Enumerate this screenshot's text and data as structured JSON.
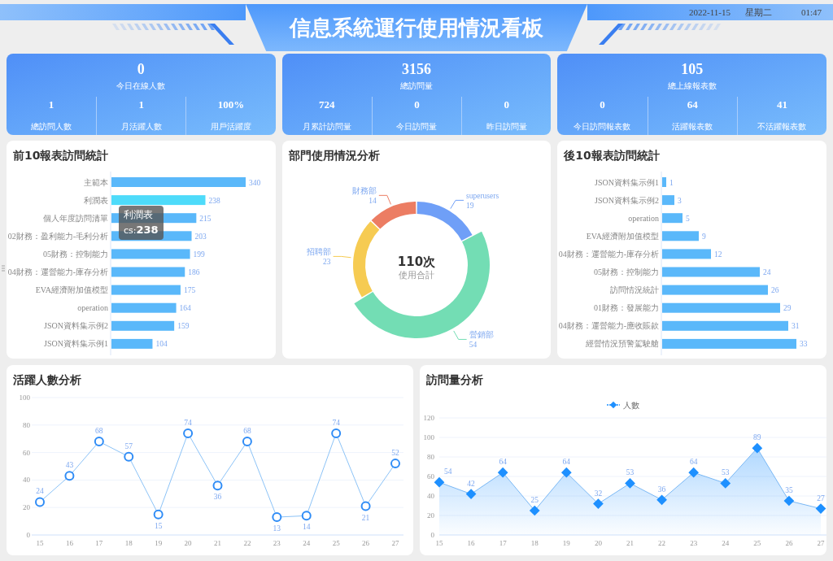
{
  "header": {
    "title": "信息系統運行使用情況看板",
    "date": "2022-11-15",
    "weekday": "星期二",
    "time": "01:47"
  },
  "stats": [
    {
      "value": "0",
      "label": "今日在線人數",
      "items": [
        {
          "value": "1",
          "label": "總訪問人數"
        },
        {
          "value": "1",
          "label": "月活躍人數"
        },
        {
          "value": "100%",
          "label": "用戶活躍度"
        }
      ]
    },
    {
      "value": "3156",
      "label": "總訪問量",
      "items": [
        {
          "value": "724",
          "label": "月累計訪問量"
        },
        {
          "value": "0",
          "label": "今日訪問量"
        },
        {
          "value": "0",
          "label": "昨日訪問量"
        }
      ]
    },
    {
      "value": "105",
      "label": "總上線報表數",
      "items": [
        {
          "value": "0",
          "label": "今日訪問報表數"
        },
        {
          "value": "64",
          "label": "活躍報表數"
        },
        {
          "value": "41",
          "label": "不活躍報表數"
        }
      ]
    }
  ],
  "top_reports": {
    "title": "前10報表訪問統計",
    "selected": [
      false,
      true,
      false,
      false,
      false,
      false,
      false,
      false,
      false,
      false
    ],
    "tooltip": {
      "title": "利潤表",
      "text": "cs:**238**"
    },
    "chart_data": {
      "type": "bar",
      "orientation": "horizontal",
      "data_labels": true,
      "categories": [
        "主範本",
        "利潤表",
        "個人年度訪問清單",
        "02財務：盈利能力-毛利分析",
        "05財務：控制能力",
        "04財務：運營能力-庫存分析",
        "EVA經濟附加值模型",
        "operation",
        "JSON資料集示例2",
        "JSON資料集示例1"
      ],
      "values": [
        340,
        238,
        215,
        203,
        199,
        186,
        175,
        164,
        159,
        104
      ]
    }
  },
  "departments": {
    "title": "部門使用情況分析",
    "center_value": "110次",
    "center_label": "使用合計",
    "selected": [
      false,
      true,
      false,
      false
    ],
    "chart_data": {
      "type": "donut",
      "categories": [
        "superusers",
        "營銷部",
        "招聘部",
        "財務部"
      ],
      "series": [
        {
          "values": [
            19,
            54,
            23,
            14
          ]
        }
      ],
      "colors": [
        "#6f9ff7",
        "#73ddb4",
        "#f6cb52",
        "#ec7d63"
      ],
      "data_labels": true
    }
  },
  "bottom_reports": {
    "title": "後10報表訪問統計",
    "chart_data": {
      "type": "bar",
      "orientation": "horizontal",
      "data_labels": true,
      "categories": [
        "JSON資料集示例1",
        "JSON資料集示例2",
        "operation",
        "EVA經濟附加值模型",
        "04財務：運營能力-庫存分析",
        "05財務：控制能力",
        "訪問情況統計",
        "01財務：發展能力",
        "04財務：運營能力-應收賬款",
        "經營情況預警駕駛艙"
      ],
      "values": [
        1,
        3,
        5,
        9,
        12,
        24,
        26,
        29,
        31,
        33
      ]
    }
  },
  "active_users": {
    "title": "活躍人數分析",
    "chart_data": {
      "type": "line",
      "categories": [
        "15",
        "16",
        "17",
        "18",
        "19",
        "20",
        "21",
        "22",
        "23",
        "24",
        "25",
        "26",
        "27"
      ],
      "ylim": [
        0,
        100
      ],
      "yticks": [
        0,
        20,
        40,
        60,
        80,
        100
      ],
      "data_labels": true,
      "grid": true,
      "series": [
        {
          "color": "#2f8cf6",
          "marker": "circle",
          "values": [
            24,
            43,
            68,
            57,
            15,
            74,
            36,
            68,
            13,
            14,
            74,
            21,
            52
          ]
        }
      ]
    }
  },
  "visits": {
    "title": "訪問量分析",
    "chart_data": {
      "type": "area",
      "categories": [
        "15",
        "16",
        "17",
        "18",
        "19",
        "20",
        "21",
        "22",
        "23",
        "24",
        "25",
        "26",
        "27"
      ],
      "ylim": [
        0,
        120
      ],
      "yticks": [
        0,
        20,
        40,
        60,
        80,
        100,
        120
      ],
      "data_labels": true,
      "grid": true,
      "series": [
        {
          "name": "人數",
          "color": "#1e90ff",
          "marker": "diamond",
          "values": [
            54,
            42,
            64,
            25,
            64,
            32,
            53,
            36,
            64,
            53,
            89,
            35,
            27
          ]
        }
      ]
    }
  }
}
